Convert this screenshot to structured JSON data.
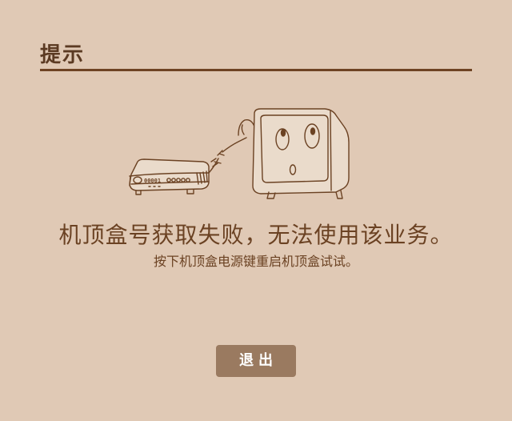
{
  "dialog": {
    "title": "提示",
    "message": "机顶盒号获取失败，无法使用该业务。",
    "submessage": "按下机顶盒电源键重启机顶盒试试。",
    "exit_label": "退出"
  },
  "illustration": {
    "stb_display": "00001",
    "icon": "broken-tv-cable-illustration"
  },
  "colors": {
    "background": "#e0c9b5",
    "text": "#6b4223",
    "rule": "#6e4323",
    "button": "#9a7a60"
  }
}
